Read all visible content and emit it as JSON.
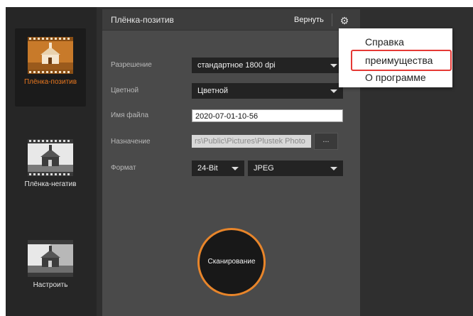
{
  "sidebar": {
    "items": [
      {
        "label": "Плёнка-позитив",
        "active": true
      },
      {
        "label": "Плёнка-негатив",
        "active": false
      },
      {
        "label": "Настроить",
        "active": false
      }
    ]
  },
  "header": {
    "title": "Плёнка-позитив",
    "return_label": "Вернуть",
    "gear_icon": "gear-icon"
  },
  "form": {
    "resolution": {
      "label": "Разрешение",
      "value": "стандартное 1800 dpi"
    },
    "color": {
      "label": "Цветной",
      "value": "Цветной"
    },
    "filename": {
      "label": "Имя файла",
      "value": "2020-07-01-10-56"
    },
    "destination": {
      "label": "Назначение",
      "value": "rs\\Public\\Pictures\\Plustek Photo",
      "browse_label": "..."
    },
    "format": {
      "label": "Формат",
      "bit_depth": "24-Bit",
      "file_type": "JPEG"
    }
  },
  "scan_button_label": "Сканирование",
  "menu": {
    "items": [
      {
        "label": "Справка"
      },
      {
        "label": "преимущества",
        "highlighted": true
      },
      {
        "label": "О программе"
      }
    ]
  },
  "colors": {
    "accent": "#e8852a",
    "highlight": "#e53935",
    "panel": "#4a4a4a",
    "sidebar": "#262626"
  }
}
